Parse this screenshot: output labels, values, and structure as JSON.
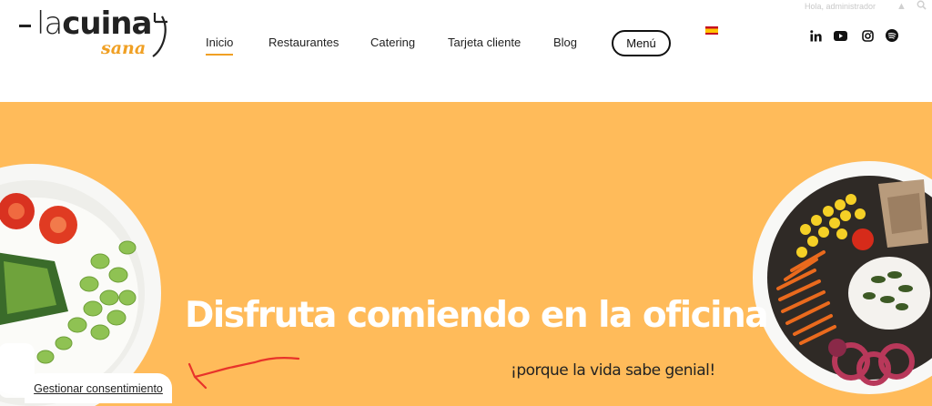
{
  "brand": {
    "name_thin": "la",
    "name_bold": "cuina",
    "script": "sana"
  },
  "nav": {
    "items": [
      {
        "label": "Inicio",
        "active": true
      },
      {
        "label": "Restaurantes",
        "active": false
      },
      {
        "label": "Catering",
        "active": false
      },
      {
        "label": "Tarjeta cliente",
        "active": false
      },
      {
        "label": "Blog",
        "active": false
      }
    ],
    "menu_button": "Menú"
  },
  "language": {
    "flag": "spain-flag-icon"
  },
  "user": {
    "greeting": "Hola, administrador"
  },
  "social": [
    "linkedin-icon",
    "youtube-icon",
    "instagram-icon",
    "spotify-icon"
  ],
  "hero": {
    "title": "Disfruta comiendo en la oficina",
    "subtitle": "¡porque la vida sabe genial!",
    "background": "#ffbb5a"
  },
  "consent": {
    "label": "Gestionar consentimiento"
  },
  "colors": {
    "accent": "#f0a024",
    "annotation": "#e8332a"
  }
}
